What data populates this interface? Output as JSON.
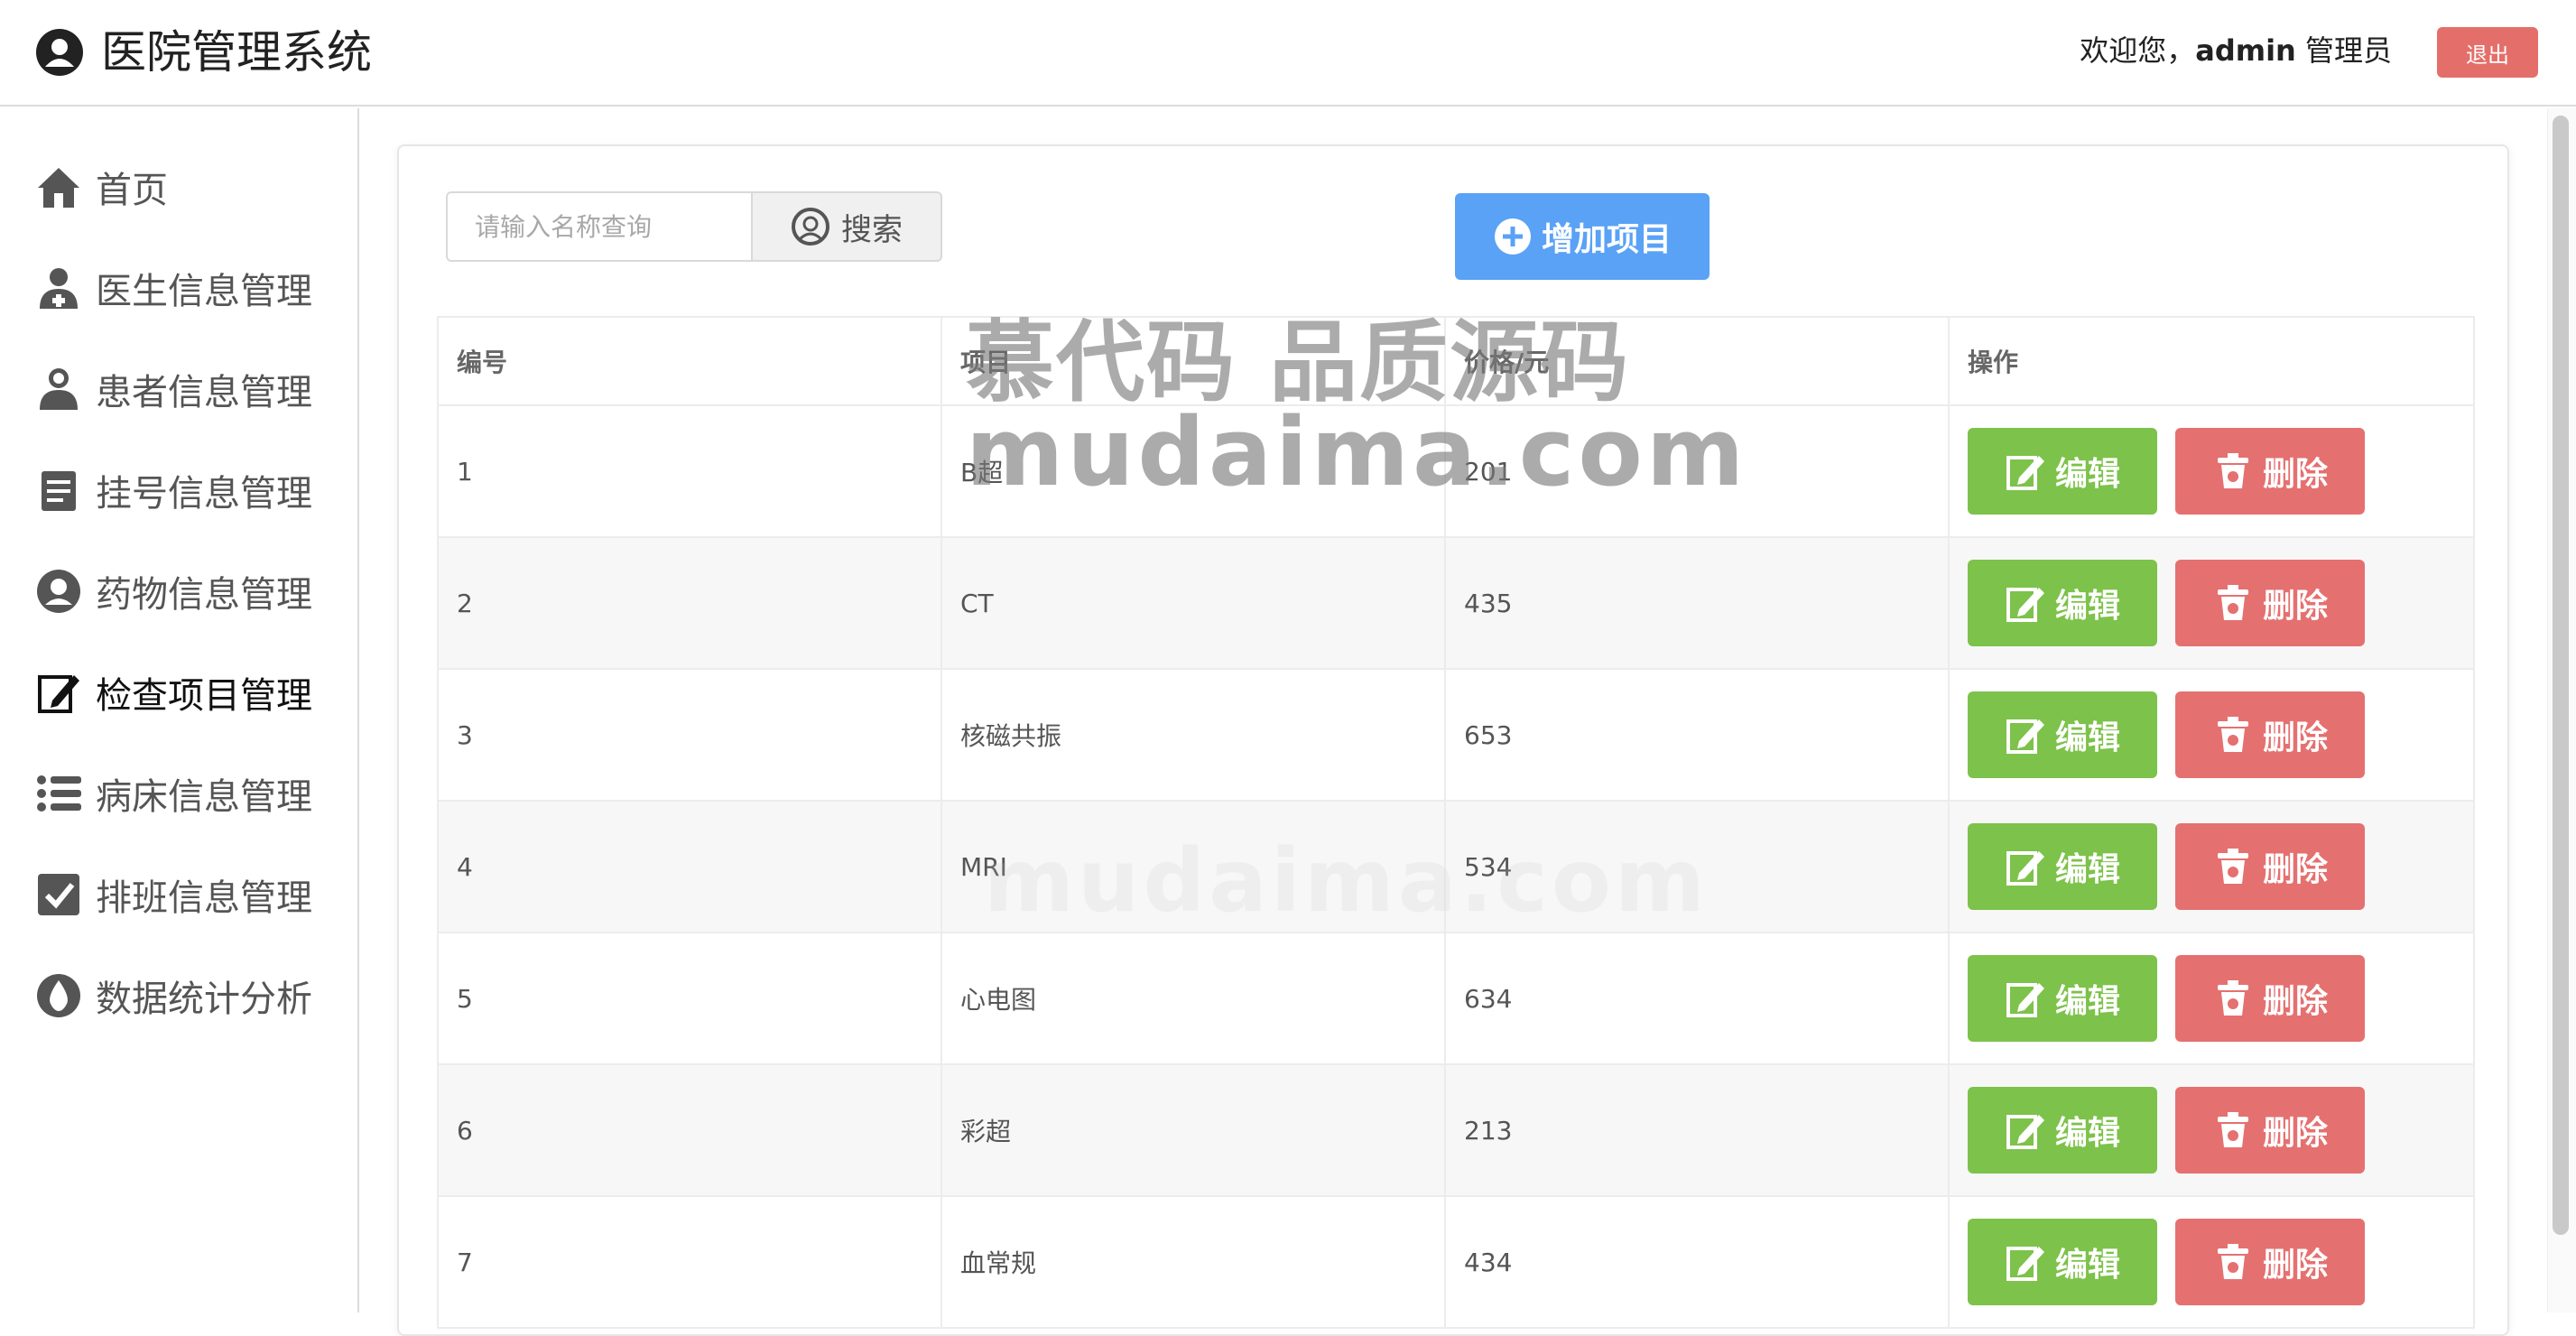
{
  "header": {
    "title": "医院管理系统",
    "welcome_prefix": "欢迎您，",
    "username": "admin",
    "role": " 管理员",
    "logout_label": "退出"
  },
  "sidebar": {
    "items": [
      {
        "label": "首页",
        "icon": "home-icon"
      },
      {
        "label": "医生信息管理",
        "icon": "doctor-icon"
      },
      {
        "label": "患者信息管理",
        "icon": "patient-icon"
      },
      {
        "label": "挂号信息管理",
        "icon": "clipboard-icon"
      },
      {
        "label": "药物信息管理",
        "icon": "medicine-icon"
      },
      {
        "label": "检查项目管理",
        "icon": "edit-icon",
        "active": true
      },
      {
        "label": "病床信息管理",
        "icon": "list-icon"
      },
      {
        "label": "排班信息管理",
        "icon": "checkbox-icon"
      },
      {
        "label": "数据统计分析",
        "icon": "drop-icon"
      }
    ]
  },
  "search": {
    "placeholder": "请输入名称查询",
    "value": "",
    "button_label": "搜索"
  },
  "add_button_label": "增加项目",
  "table": {
    "headers": [
      "编号",
      "项目",
      "价格/元",
      "操作"
    ],
    "rows": [
      {
        "id": "1",
        "name": "B超",
        "price": "201"
      },
      {
        "id": "2",
        "name": "CT",
        "price": "435"
      },
      {
        "id": "3",
        "name": "核磁共振",
        "price": "653"
      },
      {
        "id": "4",
        "name": "MRI",
        "price": "534"
      },
      {
        "id": "5",
        "name": "心电图",
        "price": "634"
      },
      {
        "id": "6",
        "name": "彩超",
        "price": "213"
      },
      {
        "id": "7",
        "name": "血常规",
        "price": "434"
      }
    ],
    "edit_label": "编辑",
    "delete_label": "删除"
  },
  "watermark": {
    "line1": "慕代码 品质源码",
    "line2": "mudaima.com"
  },
  "colors": {
    "primary": "#5aa2f5",
    "edit": "#7dc24a",
    "delete": "#e57070",
    "logout": "#e46f6a"
  }
}
